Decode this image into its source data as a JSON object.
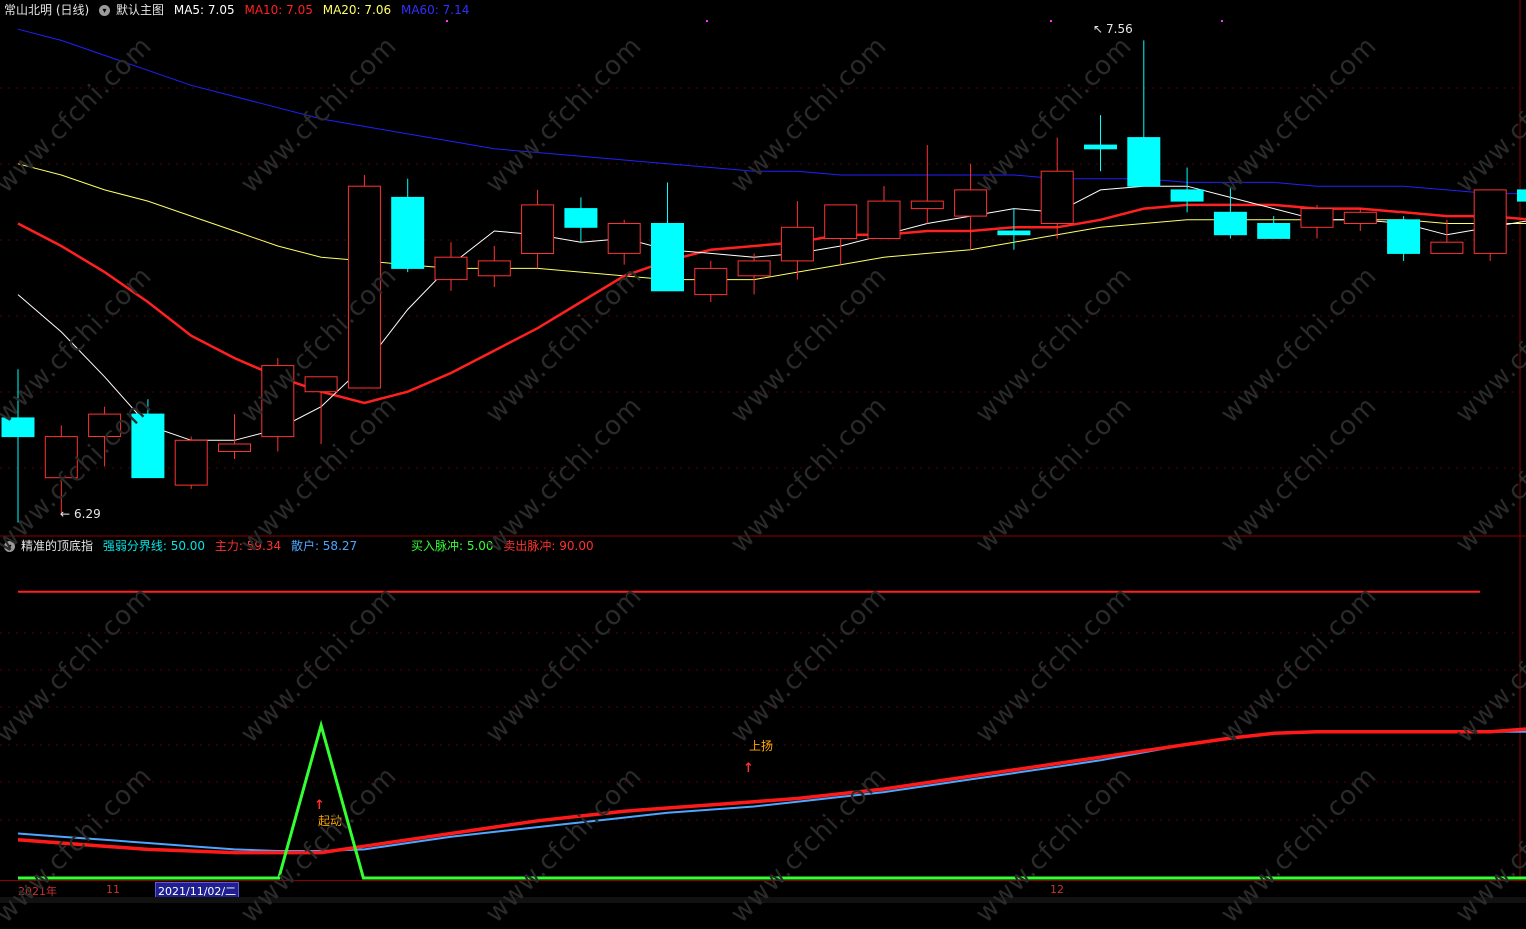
{
  "main_header": {
    "title": "常山北明 (日线)",
    "template": "默认主图",
    "ma5": "MA5: 7.05",
    "ma10": "MA10: 7.05",
    "ma20": "MA20: 7.06",
    "ma60": "MA60: 7.14"
  },
  "indicator_header": {
    "name": "精准的顶底指",
    "divider": "强弱分界线: 50.00",
    "main_force": "主力: 59.34",
    "retail": "散户: 58.27",
    "buy_pulse": "买入脉冲: 5.00",
    "sell_pulse": "卖出脉冲: 90.00"
  },
  "annotations": {
    "high_price": "7.56",
    "low_price": "6.29",
    "start_signal": "起动",
    "rise_signal": "上扬"
  },
  "date_axis": {
    "year": "2021年",
    "month_11": "11",
    "month_12": "12",
    "cursor_date": "2021/11/02/二"
  },
  "watermark": "www.cfchi.com",
  "colors": {
    "up": "#ff3232",
    "down": "#00ffff",
    "ma5": "#ffffff",
    "ma10": "#ff2020",
    "ma20": "#ffff66",
    "ma60": "#2020ff",
    "main_force": "#ff1a1a",
    "retail": "#4da6ff",
    "pulse": "#33ff33",
    "grid": "#8b0000"
  },
  "chart_data": {
    "type": "candlestick",
    "price_range": [
      6.25,
      7.62
    ],
    "candles": [
      {
        "o": 6.55,
        "h": 6.68,
        "l": 6.27,
        "c": 6.5
      },
      {
        "o": 6.39,
        "h": 6.53,
        "l": 6.29,
        "c": 6.5
      },
      {
        "o": 6.5,
        "h": 6.58,
        "l": 6.42,
        "c": 6.56
      },
      {
        "o": 6.56,
        "h": 6.6,
        "l": 6.39,
        "c": 6.39
      },
      {
        "o": 6.37,
        "h": 6.5,
        "l": 6.36,
        "c": 6.49
      },
      {
        "o": 6.46,
        "h": 6.56,
        "l": 6.44,
        "c": 6.48
      },
      {
        "o": 6.5,
        "h": 6.71,
        "l": 6.46,
        "c": 6.69
      },
      {
        "o": 6.62,
        "h": 6.66,
        "l": 6.48,
        "c": 6.66
      },
      {
        "o": 6.63,
        "h": 7.2,
        "l": 6.63,
        "c": 7.17
      },
      {
        "o": 7.14,
        "h": 7.19,
        "l": 6.94,
        "c": 6.95
      },
      {
        "o": 6.92,
        "h": 7.02,
        "l": 6.89,
        "c": 6.98
      },
      {
        "o": 6.93,
        "h": 7.01,
        "l": 6.9,
        "c": 6.97
      },
      {
        "o": 6.99,
        "h": 7.16,
        "l": 6.95,
        "c": 7.12
      },
      {
        "o": 7.11,
        "h": 7.14,
        "l": 7.02,
        "c": 7.06
      },
      {
        "o": 6.99,
        "h": 7.08,
        "l": 6.96,
        "c": 7.07
      },
      {
        "o": 7.07,
        "h": 7.18,
        "l": 6.9,
        "c": 6.89
      },
      {
        "o": 6.88,
        "h": 6.97,
        "l": 6.86,
        "c": 6.95
      },
      {
        "o": 6.93,
        "h": 6.99,
        "l": 6.88,
        "c": 6.97
      },
      {
        "o": 6.97,
        "h": 7.13,
        "l": 6.92,
        "c": 7.06
      },
      {
        "o": 7.03,
        "h": 7.1,
        "l": 6.96,
        "c": 7.12
      },
      {
        "o": 7.03,
        "h": 7.17,
        "l": 7.05,
        "c": 7.13
      },
      {
        "o": 7.11,
        "h": 7.28,
        "l": 7.07,
        "c": 7.13
      },
      {
        "o": 7.09,
        "h": 7.23,
        "l": 7.0,
        "c": 7.16
      },
      {
        "o": 7.05,
        "h": 7.11,
        "l": 7.0,
        "c": 7.04
      },
      {
        "o": 7.07,
        "h": 7.3,
        "l": 7.03,
        "c": 7.21
      },
      {
        "o": 7.28,
        "h": 7.36,
        "l": 7.21,
        "c": 7.27
      },
      {
        "o": 7.3,
        "h": 7.56,
        "l": 7.17,
        "c": 7.17
      },
      {
        "o": 7.16,
        "h": 7.22,
        "l": 7.1,
        "c": 7.13
      },
      {
        "o": 7.1,
        "h": 7.17,
        "l": 7.03,
        "c": 7.04
      },
      {
        "o": 7.07,
        "h": 7.09,
        "l": 7.03,
        "c": 7.03
      },
      {
        "o": 7.06,
        "h": 7.12,
        "l": 7.03,
        "c": 7.11
      },
      {
        "o": 7.07,
        "h": 7.11,
        "l": 7.05,
        "c": 7.1
      },
      {
        "o": 7.08,
        "h": 7.09,
        "l": 6.97,
        "c": 6.99
      },
      {
        "o": 6.99,
        "h": 7.08,
        "l": 6.99,
        "c": 7.02
      },
      {
        "o": 6.99,
        "h": 7.16,
        "l": 6.97,
        "c": 7.16
      },
      {
        "o": 7.16,
        "h": 7.22,
        "l": 7.11,
        "c": 7.13
      }
    ],
    "ma5": [
      6.88,
      6.78,
      6.66,
      6.53,
      6.49,
      6.49,
      6.52,
      6.58,
      6.69,
      6.84,
      6.96,
      7.05,
      7.04,
      7.02,
      7.03,
      7.0,
      6.99,
      6.98,
      6.99,
      7.01,
      7.04,
      7.07,
      7.09,
      7.11,
      7.1,
      7.16,
      7.17,
      7.17,
      7.14,
      7.11,
      7.08,
      7.08,
      7.07,
      7.04,
      7.06,
      7.08
    ],
    "ma10": [
      7.07,
      7.01,
      6.94,
      6.86,
      6.77,
      6.71,
      6.66,
      6.62,
      6.59,
      6.62,
      6.67,
      6.73,
      6.79,
      6.86,
      6.93,
      6.97,
      7.0,
      7.01,
      7.02,
      7.04,
      7.04,
      7.05,
      7.05,
      7.06,
      7.06,
      7.08,
      7.11,
      7.12,
      7.12,
      7.12,
      7.11,
      7.11,
      7.1,
      7.09,
      7.09,
      7.08
    ],
    "ma20": [
      7.23,
      7.2,
      7.16,
      7.13,
      7.09,
      7.05,
      7.01,
      6.98,
      6.97,
      6.96,
      6.95,
      6.95,
      6.95,
      6.94,
      6.93,
      6.92,
      6.92,
      6.92,
      6.94,
      6.96,
      6.98,
      6.99,
      7.0,
      7.02,
      7.04,
      7.06,
      7.07,
      7.08,
      7.08,
      7.08,
      7.08,
      7.08,
      7.08,
      7.07,
      7.07,
      7.07
    ],
    "ma60": [
      7.59,
      7.56,
      7.52,
      7.48,
      7.44,
      7.41,
      7.38,
      7.35,
      7.33,
      7.31,
      7.29,
      7.27,
      7.26,
      7.25,
      7.24,
      7.23,
      7.22,
      7.21,
      7.21,
      7.2,
      7.2,
      7.2,
      7.2,
      7.2,
      7.19,
      7.19,
      7.19,
      7.18,
      7.18,
      7.18,
      7.17,
      7.17,
      7.17,
      7.16,
      7.15,
      7.15
    ],
    "indicator": {
      "range": [
        0,
        100
      ],
      "divider": 50,
      "sell_pulse_level": 90,
      "main_force": [
        12,
        11,
        10,
        9,
        8.5,
        8,
        8,
        8,
        10,
        12,
        14,
        16,
        18,
        19.5,
        21,
        22,
        23,
        24,
        25,
        26.5,
        28,
        30,
        32,
        34,
        36,
        38,
        40,
        42,
        44,
        45.5,
        46,
        46,
        46,
        46,
        46,
        47
      ],
      "retail": [
        14,
        13,
        12,
        11,
        10,
        9,
        8.5,
        8.5,
        9,
        11,
        13,
        14.5,
        16,
        17.5,
        19,
        20.5,
        21.5,
        22.5,
        24,
        25.5,
        27,
        29,
        31,
        33,
        35,
        37,
        39.5,
        42,
        44,
        45.5,
        46,
        46,
        46,
        46,
        46,
        46
      ],
      "pulse": [
        0,
        0,
        0,
        0,
        0,
        0,
        0,
        48,
        0,
        0,
        0,
        0,
        0,
        0,
        0,
        0,
        0,
        0,
        0,
        0,
        0,
        0,
        0,
        0,
        0,
        0,
        0,
        0,
        0,
        0,
        0,
        0,
        0,
        0,
        0,
        0
      ]
    }
  }
}
